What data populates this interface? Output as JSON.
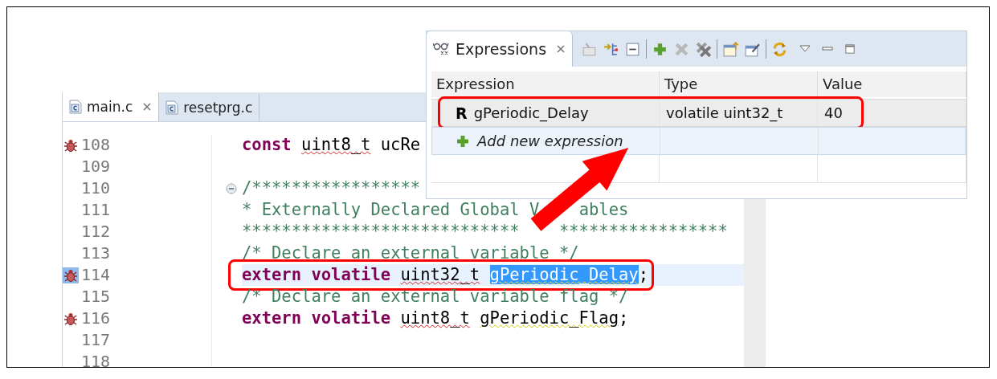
{
  "editor": {
    "tabs": [
      {
        "label": "main.c",
        "selected": true
      },
      {
        "label": "resetprg.c",
        "selected": false
      }
    ],
    "lines": [
      {
        "number": "108",
        "breakpoint": true,
        "current": false,
        "foldable": false,
        "callout": false,
        "code": [
          {
            "kind": "keyword",
            "text": "const"
          },
          {
            "kind": "type",
            "text": "uint8_t",
            "space_before": true
          },
          {
            "kind": "plain",
            "text": "ucRe",
            "space_before": true
          }
        ]
      },
      {
        "number": "109",
        "breakpoint": false,
        "current": false,
        "foldable": false,
        "callout": false
      },
      {
        "number": "110",
        "breakpoint": false,
        "current": false,
        "foldable": true,
        "callout": false,
        "code": [
          {
            "kind": "comment",
            "text": "/*****************"
          }
        ]
      },
      {
        "number": "111",
        "breakpoint": false,
        "current": false,
        "foldable": false,
        "callout": false,
        "code": [
          {
            "kind": "comment",
            "text": "* Externally Declared Global V"
          },
          {
            "kind": "comment",
            "text": "ables",
            "covered_before": true
          }
        ]
      },
      {
        "number": "112",
        "breakpoint": false,
        "current": false,
        "foldable": false,
        "callout": false,
        "code": [
          {
            "kind": "comment",
            "text": "****************************"
          },
          {
            "kind": "comment",
            "text": "*****************",
            "covered_before": true
          }
        ]
      },
      {
        "number": "113",
        "breakpoint": false,
        "current": false,
        "foldable": false,
        "callout": false,
        "code": [
          {
            "kind": "comment",
            "text": "/* Declare an external variable */"
          }
        ]
      },
      {
        "number": "114",
        "breakpoint": true,
        "current": true,
        "foldable": false,
        "callout": true,
        "code": [
          {
            "kind": "keyword",
            "text": "extern volatile"
          },
          {
            "kind": "type",
            "text": "uint32_t",
            "space_before": true
          },
          {
            "kind": "selection",
            "text": "gPeriodic_Delay",
            "space_before": true
          },
          {
            "kind": "plain",
            "text": ";"
          }
        ]
      },
      {
        "number": "115",
        "breakpoint": false,
        "current": false,
        "foldable": false,
        "callout": false,
        "code": [
          {
            "kind": "comment",
            "text": "/* Declare an external variable flag */"
          }
        ]
      },
      {
        "number": "116",
        "breakpoint": true,
        "current": false,
        "foldable": false,
        "callout": false,
        "code": [
          {
            "kind": "keyword",
            "text": "extern volatile"
          },
          {
            "kind": "type",
            "text": "uint8_t",
            "space_before": true
          },
          {
            "kind": "symbol",
            "text": "gPeriodic_Flag",
            "space_before": true
          },
          {
            "kind": "plain",
            "text": ";"
          }
        ]
      },
      {
        "number": "117",
        "breakpoint": false,
        "current": false,
        "foldable": false,
        "callout": false
      },
      {
        "number": "118",
        "breakpoint": false,
        "current": false,
        "foldable": false,
        "callout": false
      }
    ]
  },
  "expressions": {
    "tab": "Expressions",
    "columns": [
      "Expression",
      "Type",
      "Value"
    ],
    "rows": [
      {
        "marker": "R",
        "expression": "gPeriodic_Delay",
        "type": "volatile uint32_t",
        "value": "40",
        "callout": true
      }
    ],
    "add_row": "Add new expression"
  }
}
